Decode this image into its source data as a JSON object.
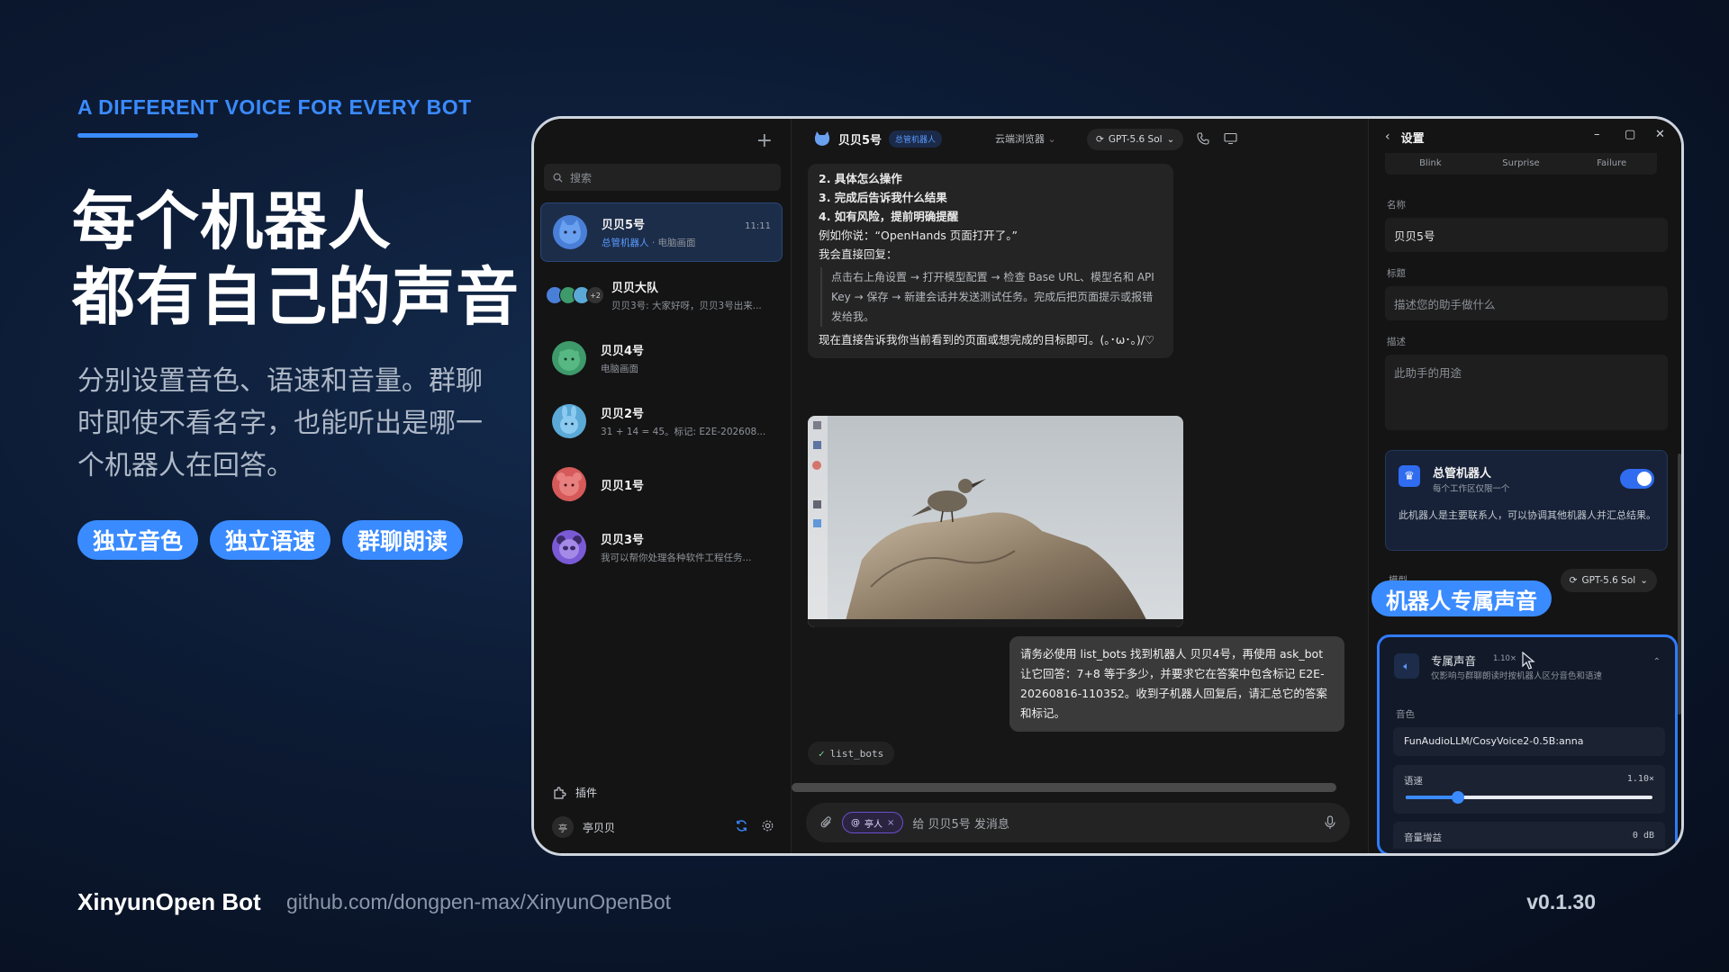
{
  "marketing": {
    "eyebrow": "A DIFFERENT VOICE FOR EVERY BOT",
    "headline_line1": "每个机器人",
    "headline_line2": "都有自己的声音",
    "subtext": "分别设置音色、语速和音量。群聊时即使不看名字，也能听出是哪一个机器人在回答。",
    "pills": [
      "独立音色",
      "独立语速",
      "群聊朗读"
    ],
    "footer_brand": "XinyunOpen Bot",
    "footer_url": "github.com/dongpen-max/XinyunOpenBot",
    "footer_version": "v0.1.30",
    "accent_color": "#3a8bff"
  },
  "sidebar": {
    "search_placeholder": "搜索",
    "conversations": [
      {
        "name": "贝贝5号",
        "tag": "总管机器人",
        "sub": " · 电脑画面",
        "time": "11:11",
        "active": true,
        "avatar_color": "#4a7fd8"
      },
      {
        "name": "贝贝大队",
        "tag": "",
        "sub": "贝贝3号: 大家好呀，贝贝3号出来...",
        "time": "",
        "active": false,
        "avatar_color": "#4a7fd8",
        "group_count": "+2"
      },
      {
        "name": "贝贝4号",
        "tag": "",
        "sub": "电脑画面",
        "time": "",
        "active": false,
        "avatar_color": "#3e9a6a"
      },
      {
        "name": "贝贝2号",
        "tag": "",
        "sub": "31 + 14 = 45。标记: E2E-202608...",
        "time": "",
        "active": false,
        "avatar_color": "#5aa9d6"
      },
      {
        "name": "贝贝1号",
        "tag": "",
        "sub": "",
        "time": "",
        "active": false,
        "avatar_color": "#d65a5a"
      },
      {
        "name": "贝贝3号",
        "tag": "",
        "sub": "我可以帮你处理各种软件工程任务...",
        "time": "",
        "active": false,
        "avatar_color": "#7b5ad6"
      }
    ],
    "plugin_label": "插件",
    "user_name": "亭贝贝",
    "user_initial": "亭"
  },
  "chat": {
    "title": "贝贝5号",
    "title_tag": "总管机器人",
    "browser_label": "云端浏览器",
    "model_label": "GPT-5.6 Sol",
    "bot_message": {
      "line1": "2. 具体怎么操作",
      "line2": "3. 完成后告诉我什么结果",
      "line3": "4. 如有风险，提前明确提醒",
      "line4": "例如你说：“OpenHands 页面打开了。”",
      "line5": "我会直接回复：",
      "quote": "点击右上角设置 → 打开模型配置 → 检查 Base URL、模型名和 API Key → 保存 → 新建会话并发送测试任务。完成后把页面提示或报错发给我。",
      "line6": "现在直接告诉我你当前看到的页面或想完成的目标即可。(｡･ω･｡)/♡"
    },
    "user_message": "请务必使用 list_bots 找到机器人 贝贝4号，再使用 ask_bot 让它回答：7+8 等于多少，并要求它在答案中包含标记 E2E-20260816-110352。收到子机器人回复后，请汇总它的答案和标记。",
    "tool_chip": "list_bots",
    "input_mention": "亭人",
    "input_placeholder": "给 贝贝5号 发消息"
  },
  "settings": {
    "title": "设置",
    "emotions": [
      "Blink",
      "Surprise",
      "Failure"
    ],
    "name_label": "名称",
    "name_value": "贝贝5号",
    "title_label": "标题",
    "title_placeholder": "描述您的助手做什么",
    "desc_label": "描述",
    "desc_placeholder": "此助手的用途",
    "admin_title": "总管机器人",
    "admin_sub": "每个工作区仅限一个",
    "admin_desc": "此机器人是主要联系人，可以协调其他机器人并汇总结果。",
    "admin_enabled": true,
    "model_label": "模型",
    "model_value": "GPT-5.6 Sol",
    "floating_tag": "机器人专属声音",
    "voice_title": "专属声音",
    "voice_speed_badge": "1.10×",
    "voice_sub": "仅影响与群聊朗读时按机器人区分音色和语速",
    "voice_label": "音色",
    "voice_value": "FunAudioLLM/CosyVoice2-0.5B:anna",
    "speed_label": "语速",
    "speed_value": "1.10×",
    "speed_fraction": 0.21,
    "gain_label": "音量增益",
    "gain_value": "0 dB"
  }
}
